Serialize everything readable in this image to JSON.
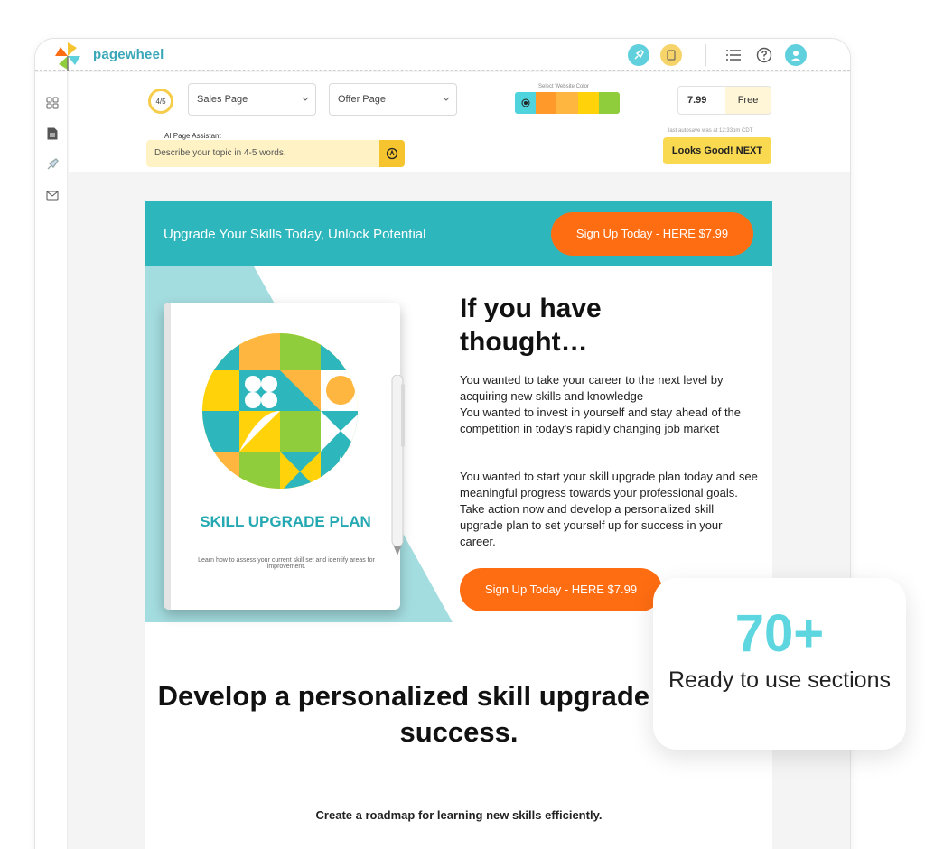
{
  "app": {
    "brand": "pagewheel"
  },
  "toolbar": {
    "step": "4/5",
    "page_type": "Sales Page",
    "offer_type": "Offer Page",
    "color_label": "Select Website Color",
    "colors": [
      "#4fd3dc",
      "#ff9a2a",
      "#ffb640",
      "#ffd20a",
      "#8fcd3c"
    ],
    "price": "7.99",
    "free_label": "Free",
    "ai_label": "AI Page Assistant",
    "ai_placeholder": "Describe your topic in 4-5 words.",
    "save_note": "last autosave was at 12:33pm CDT",
    "next_label": "Looks Good! NEXT"
  },
  "page": {
    "banner_text": "Upgrade Your Skills Today, Unlock Potential",
    "cta_label": "Sign Up Today - HERE $7.99",
    "book_title": "SKILL UPGRADE PLAN",
    "book_subtitle": "Learn how to assess your current skill set and identify areas for improvement.",
    "headline": "If you have thought…",
    "para1": "You wanted to take your career to the next level by acquiring new skills and knowledge",
    "para2": "You wanted to invest in yourself and stay ahead of the competition in today's rapidly changing job market",
    "para3": "You wanted to start your skill upgrade plan today and see meaningful progress towards your professional goals. Take action now and develop a personalized skill upgrade plan to set yourself up for success in your career.",
    "section_title": "Develop a personalized skill upgrade plan for success.",
    "section_subtitle": "Create a roadmap for learning new skills efficiently."
  },
  "promo": {
    "count": "70+",
    "label": "Ready to use sections"
  },
  "theme": {
    "teal": "#2eb6bd",
    "orange": "#ff6d12",
    "yellow": "#f9d94f"
  }
}
